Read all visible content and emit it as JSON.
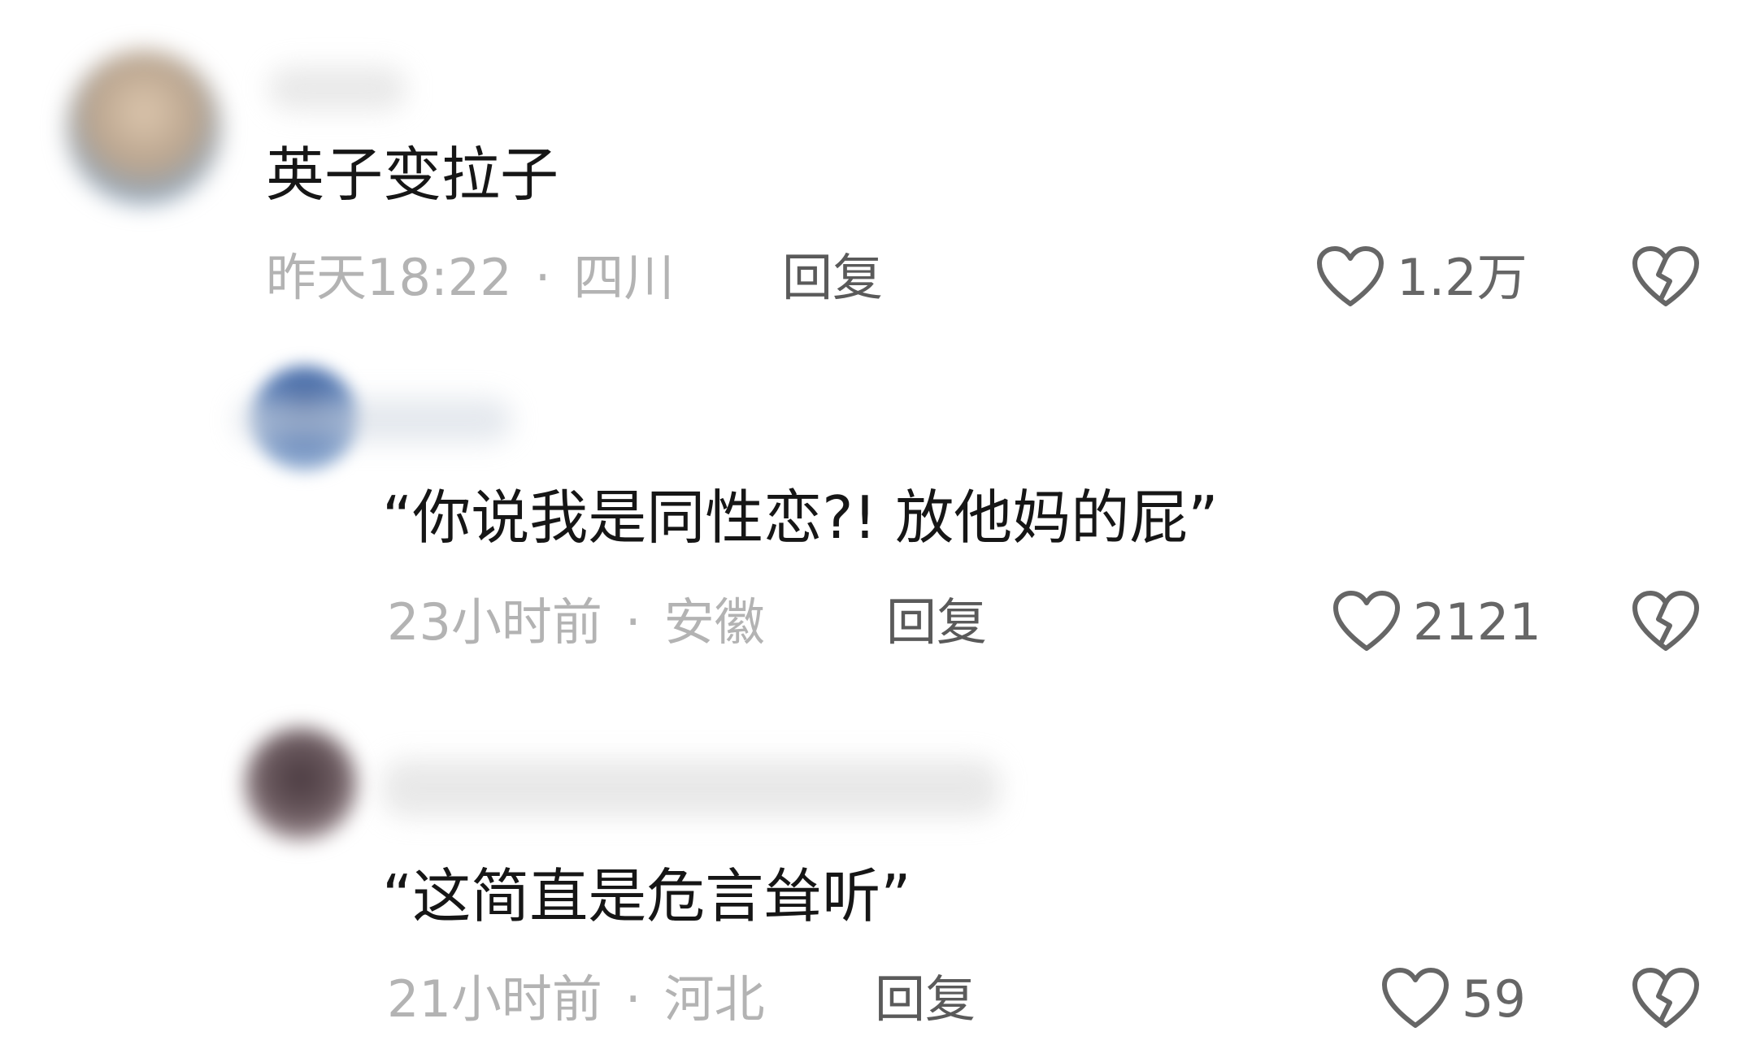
{
  "comments": [
    {
      "text": "英子变拉子",
      "time": "昨天18:22",
      "location": "四川",
      "separator": "·",
      "reply_label": "回复",
      "like_count": "1.2万",
      "avatar_color": "#c9b39a"
    },
    {
      "text": "“你说我是同性恋?! 放他妈的屁”",
      "time": "23小时前",
      "location": "安徽",
      "separator": "·",
      "reply_label": "回复",
      "like_count": "2121",
      "avatar_color": "#4a6fa5"
    },
    {
      "text": "“这简直是危言耸听”",
      "time": "21小时前",
      "location": "河北",
      "separator": "·",
      "reply_label": "回复",
      "like_count": "59",
      "avatar_color": "#6b5a5f"
    }
  ],
  "icons": {
    "like": "heart-outline-icon",
    "dislike": "broken-heart-icon"
  },
  "colors": {
    "text": "#161616",
    "meta": "#b3b3b3",
    "reply": "#5a5a5a",
    "icon": "#666666"
  }
}
